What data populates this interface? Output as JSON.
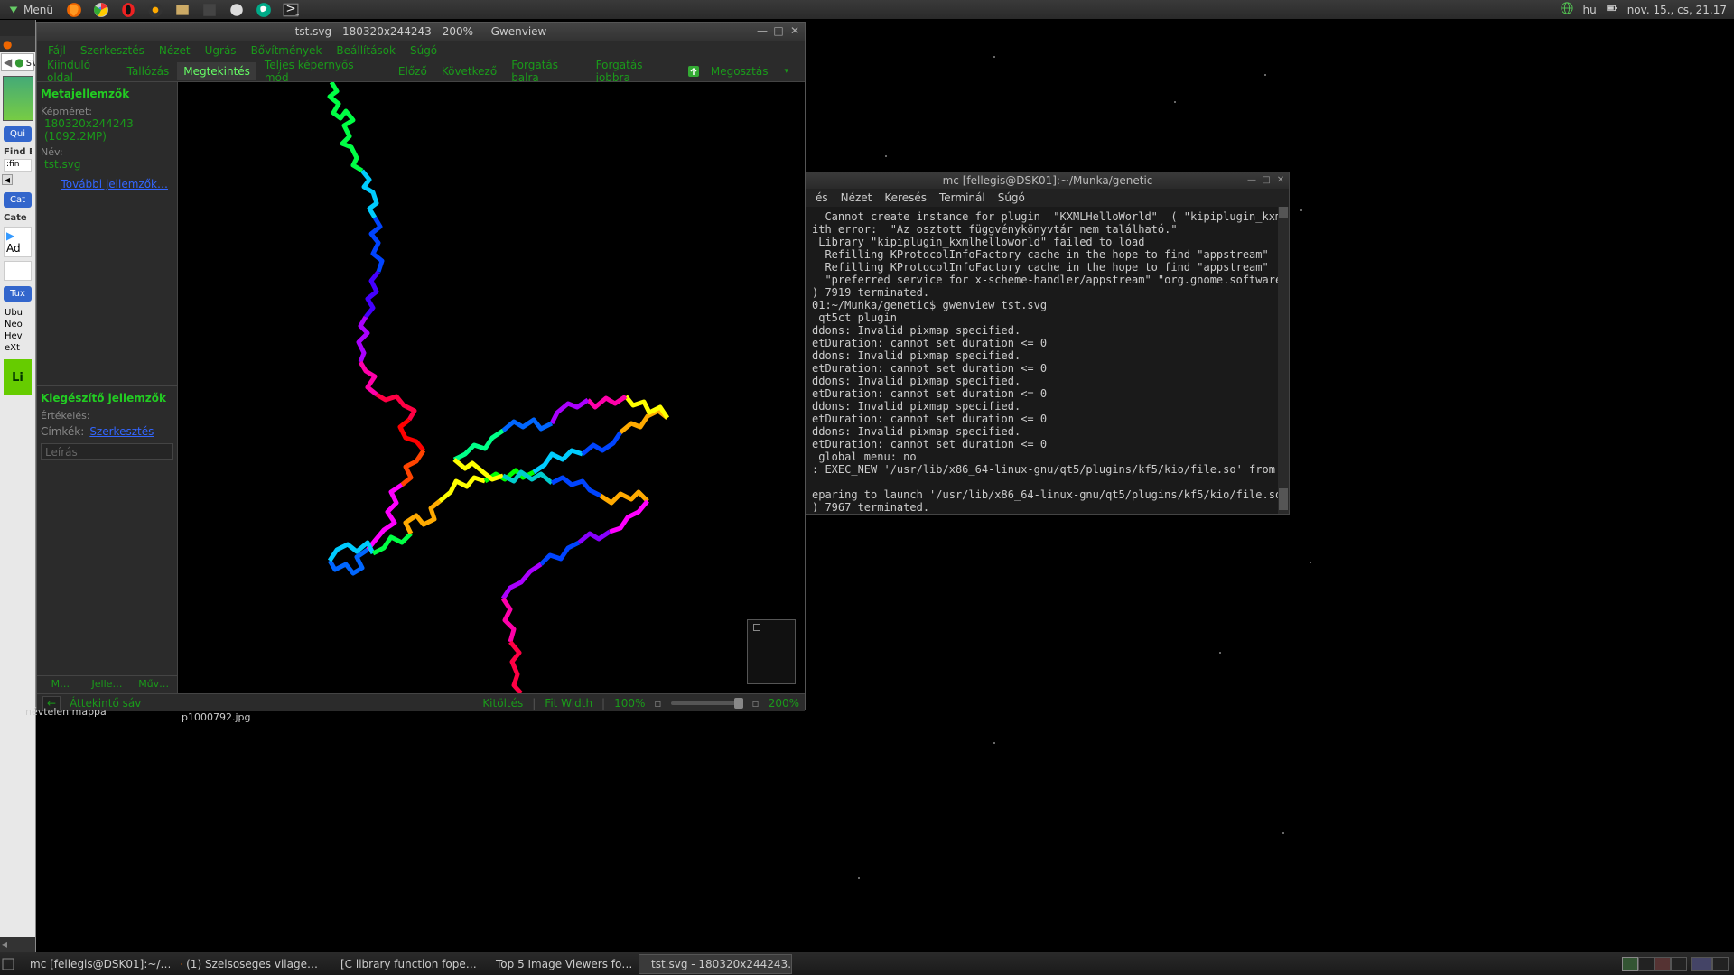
{
  "panel": {
    "menu_label": "Menü",
    "lang": "hu",
    "clock": "nov. 15., cs, 21.17"
  },
  "browser": {
    "tab_label": "sv",
    "back": "←",
    "find_hd": "Find E",
    "find_val": ":fin",
    "quick_btn": "Qui",
    "cat_btn": "Cat",
    "cat_lab": "Cate",
    "add_lab": "Ad",
    "tux_btn": "Tux",
    "items": [
      "Ubu",
      "Neo",
      "Hev",
      "eXt"
    ],
    "big": "Li",
    "folder": "névtelen mappa"
  },
  "gwen": {
    "title": "tst.svg - 180320x244243 - 200% — Gwenview",
    "menus": [
      "Fájl",
      "Szerkesztés",
      "Nézet",
      "Ugrás",
      "Bővítmények",
      "Beállítások",
      "Súgó"
    ],
    "tools": {
      "start": "Kiinduló oldal",
      "browse": "Tallózás",
      "view": "Megtekintés",
      "fullscreen": "Teljes képernyős mód",
      "prev": "Előző",
      "next": "Következő",
      "rotl": "Forgatás balra",
      "rotr": "Forgatás jobbra",
      "share": "Megosztás"
    },
    "meta": {
      "hd": "Metajellemzők",
      "size_lab": "Képméret:",
      "size_val": "180320x244243 (1092.2MP)",
      "name_lab": "Név:",
      "name_val": "tst.svg",
      "more": "További jellemzők…"
    },
    "extra": {
      "hd": "Kiegészítő jellemzők",
      "rating_lab": "Értékelés:",
      "tags_lab": "Címkék:",
      "tags_edit": "Szerkesztés",
      "desc": "Leírás"
    },
    "side_tabs": [
      "M…",
      "Jelle…",
      "Műv…"
    ],
    "status": {
      "back": "←",
      "overview": "Áttekintő sáv",
      "fill": "Kitöltés",
      "fitw": "Fit Width",
      "p100": "100%",
      "zoom": "200%"
    },
    "below_file": "p1000792.jpg"
  },
  "term": {
    "title": "mc [fellegis@DSK01]:~/Munka/genetic",
    "menus": [
      "és",
      "Nézet",
      "Keresés",
      "Terminál",
      "Súgó"
    ],
    "lines": [
      "  Cannot create instance for plugin  \"KXMLHelloWorld\"  ( \"kipiplugin_kxmlhell",
      "ith error:  \"Az osztott függvénykönyvtár nem található.\"",
      " Library \"kipiplugin_kxmlhelloworld\" failed to load",
      "  Refilling KProtocolInfoFactory cache in the hope to find \"appstream\"",
      "  Refilling KProtocolInfoFactory cache in the hope to find \"appstream\"",
      "  \"preferred service for x-scheme-handler/appstream\" \"org.gnome.software\"",
      ") 7919 terminated.",
      "01:~/Munka/genetic$ gwenview tst.svg",
      " qt5ct plugin",
      "ddons: Invalid pixmap specified.",
      "etDuration: cannot set duration <= 0",
      "ddons: Invalid pixmap specified.",
      "etDuration: cannot set duration <= 0",
      "ddons: Invalid pixmap specified.",
      "etDuration: cannot set duration <= 0",
      "ddons: Invalid pixmap specified.",
      "etDuration: cannot set duration <= 0",
      "ddons: Invalid pixmap specified.",
      "etDuration: cannot set duration <= 0",
      " global menu: no",
      ": EXEC_NEW '/usr/lib/x86_64-linux-gnu/qt5/plugins/kf5/kio/file.so' from launc",
      "",
      "eparing to launch '/usr/lib/x86_64-linux-gnu/qt5/plugins/kf5/kio/file.so'",
      ") 7967 terminated."
    ]
  },
  "taskbar": {
    "tasks": [
      {
        "label": "mc [fellegis@DSK01]:~/…",
        "icon": "term"
      },
      {
        "label": "(1) Szelsoseges vilage…",
        "icon": "ff"
      },
      {
        "label": "[C library function fope…",
        "icon": "ff"
      },
      {
        "label": "Top 5 Image Viewers fo…",
        "icon": "ff"
      },
      {
        "label": "tst.svg - 180320x244243…",
        "icon": "gwen"
      }
    ]
  }
}
